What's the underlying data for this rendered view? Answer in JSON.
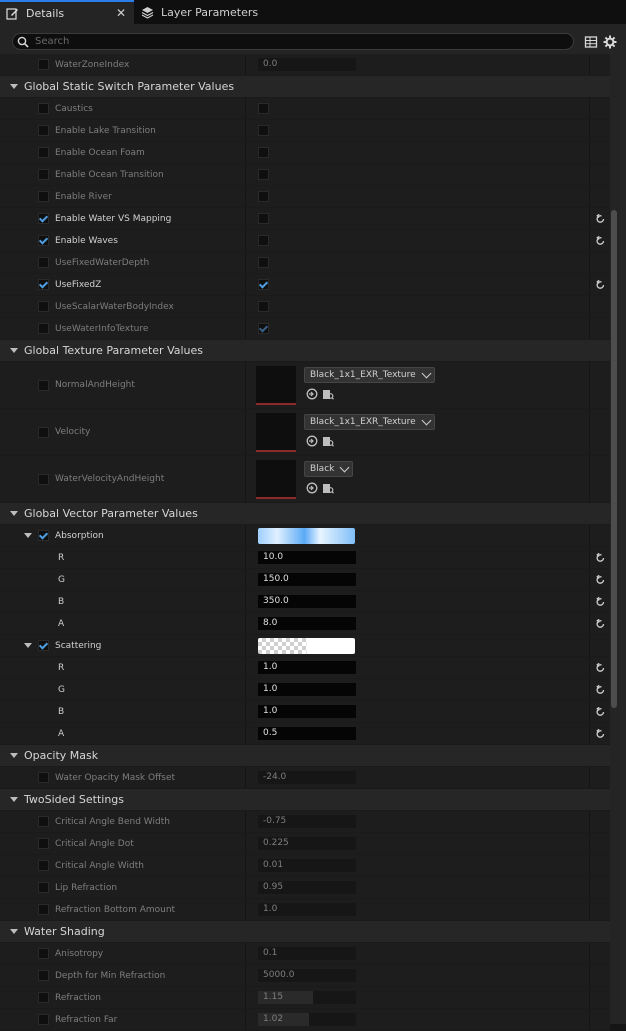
{
  "tabs": [
    {
      "label": "Details",
      "close": "✕",
      "icon": "pencil-icon"
    },
    {
      "label": "Layer Parameters",
      "icon": "layers-icon"
    }
  ],
  "search": {
    "placeholder": "Search"
  },
  "colors": {
    "accent": "#2b7de9",
    "check": "#4d9de0",
    "panel": "#242424",
    "header": "#262626",
    "row": "#1d1d1d"
  },
  "rows": {
    "water_zone_index": {
      "label": "WaterZoneIndex",
      "value": "0.0"
    },
    "static_switch": {
      "title": "Global Static Switch Parameter Values",
      "items": [
        {
          "label": "Caustics"
        },
        {
          "label": "Enable Lake Transition"
        },
        {
          "label": "Enable Ocean Foam"
        },
        {
          "label": "Enable Ocean Transition"
        },
        {
          "label": "Enable River"
        },
        {
          "label": "Enable Water VS Mapping"
        },
        {
          "label": "Enable Waves"
        },
        {
          "label": "UseFixedWaterDepth"
        },
        {
          "label": "UseFixedZ"
        },
        {
          "label": "UseScalarWaterBodyIndex"
        },
        {
          "label": "UseWaterInfoTexture"
        }
      ]
    },
    "texture": {
      "title": "Global Texture Parameter Values",
      "items": [
        {
          "label": "NormalAndHeight",
          "asset": "Black_1x1_EXR_Texture"
        },
        {
          "label": "Velocity",
          "asset": "Black_1x1_EXR_Texture"
        },
        {
          "label": "WaterVelocityAndHeight",
          "asset": "Black"
        }
      ]
    },
    "vector": {
      "title": "Global Vector Parameter Values",
      "absorption": {
        "label": "Absorption",
        "r_label": "R",
        "r": "10.0",
        "g_label": "G",
        "g": "150.0",
        "b_label": "B",
        "b": "350.0",
        "a_label": "A",
        "a": "8.0"
      },
      "scattering": {
        "label": "Scattering",
        "r_label": "R",
        "r": "1.0",
        "g_label": "G",
        "g": "1.0",
        "b_label": "B",
        "b": "1.0",
        "a_label": "A",
        "a": "0.5"
      }
    },
    "opacity": {
      "title": "Opacity Mask",
      "offset_label": "Water Opacity Mask Offset",
      "offset": "-24.0"
    },
    "twosided": {
      "title": "TwoSided Settings",
      "items": [
        {
          "label": "Critical Angle Bend Width",
          "value": "-0.75"
        },
        {
          "label": "Critical Angle Dot",
          "value": "0.225"
        },
        {
          "label": "Critical Angle Width",
          "value": "0.01"
        },
        {
          "label": "Lip Refraction",
          "value": "0.95"
        },
        {
          "label": "Refraction Bottom Amount",
          "value": "1.0"
        }
      ]
    },
    "shading": {
      "title": "Water Shading",
      "items": [
        {
          "label": "Anisotropy",
          "value": "0.1"
        },
        {
          "label": "Depth for Min Refraction",
          "value": "5000.0"
        },
        {
          "label": "Refraction",
          "value": "1.15"
        },
        {
          "label": "Refraction Far",
          "value": "1.02"
        }
      ]
    }
  }
}
